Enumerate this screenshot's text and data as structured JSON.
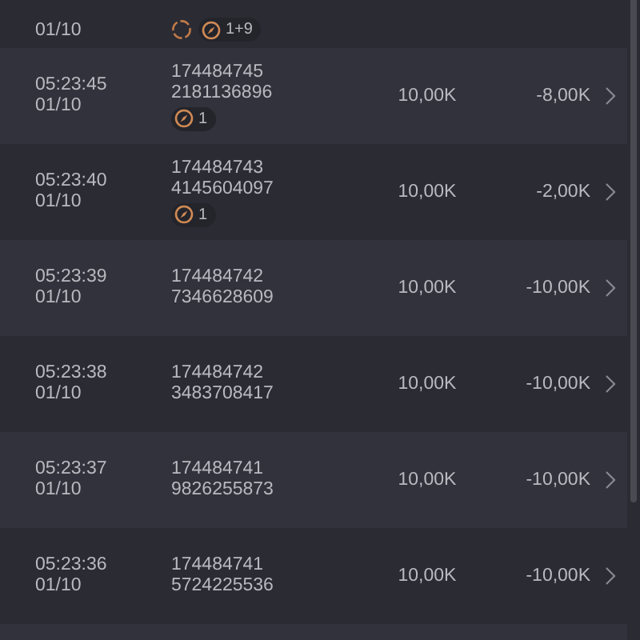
{
  "rows": [
    {
      "date": "01/10",
      "id_lines": [],
      "badges": [
        {
          "kind": "spinner"
        },
        {
          "kind": "count",
          "label": "1+9"
        }
      ]
    },
    {
      "time": "05:23:45",
      "date": "01/10",
      "id_lines": [
        "174484745",
        "2181136896"
      ],
      "amount": "10,00K",
      "result": "-8,00K",
      "badges": [
        {
          "kind": "count",
          "label": "1"
        }
      ]
    },
    {
      "time": "05:23:40",
      "date": "01/10",
      "id_lines": [
        "174484743",
        "4145604097"
      ],
      "amount": "10,00K",
      "result": "-2,00K",
      "badges": [
        {
          "kind": "count",
          "label": "1"
        }
      ]
    },
    {
      "time": "05:23:39",
      "date": "01/10",
      "id_lines": [
        "174484742",
        "7346628609"
      ],
      "amount": "10,00K",
      "result": "-10,00K",
      "badges": []
    },
    {
      "time": "05:23:38",
      "date": "01/10",
      "id_lines": [
        "174484742",
        "3483708417"
      ],
      "amount": "10,00K",
      "result": "-10,00K",
      "badges": []
    },
    {
      "time": "05:23:37",
      "date": "01/10",
      "id_lines": [
        "174484741",
        "9826255873"
      ],
      "amount": "10,00K",
      "result": "-10,00K",
      "badges": []
    },
    {
      "time": "05:23:36",
      "date": "01/10",
      "id_lines": [
        "174484741",
        "5724225536"
      ],
      "amount": "10,00K",
      "result": "-10,00K",
      "badges": []
    }
  ]
}
